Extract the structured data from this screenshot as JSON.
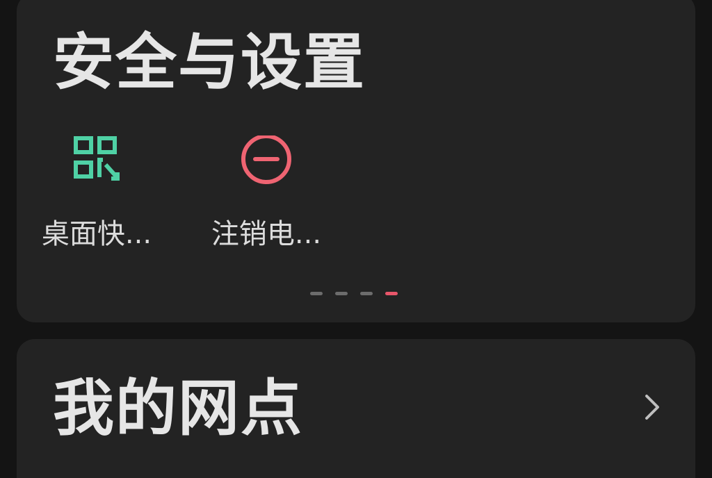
{
  "security_section": {
    "title": "安全与设置",
    "shortcuts": [
      {
        "label": "桌面快...",
        "icon": "qr-scan-icon",
        "color": "#4fd1a5"
      },
      {
        "label": "注销电...",
        "icon": "minus-circle-icon",
        "color": "#ef6472"
      }
    ],
    "pager": {
      "total": 4,
      "active_index": 3
    }
  },
  "outlets_section": {
    "title": "我的网点",
    "chevron_icon": "chevron-right-icon"
  },
  "colors": {
    "background": "#141414",
    "card": "#232323",
    "text": "#e6e6e6",
    "accent_green": "#4fd1a5",
    "accent_red": "#ef6472",
    "pager_active": "#e8566a"
  }
}
